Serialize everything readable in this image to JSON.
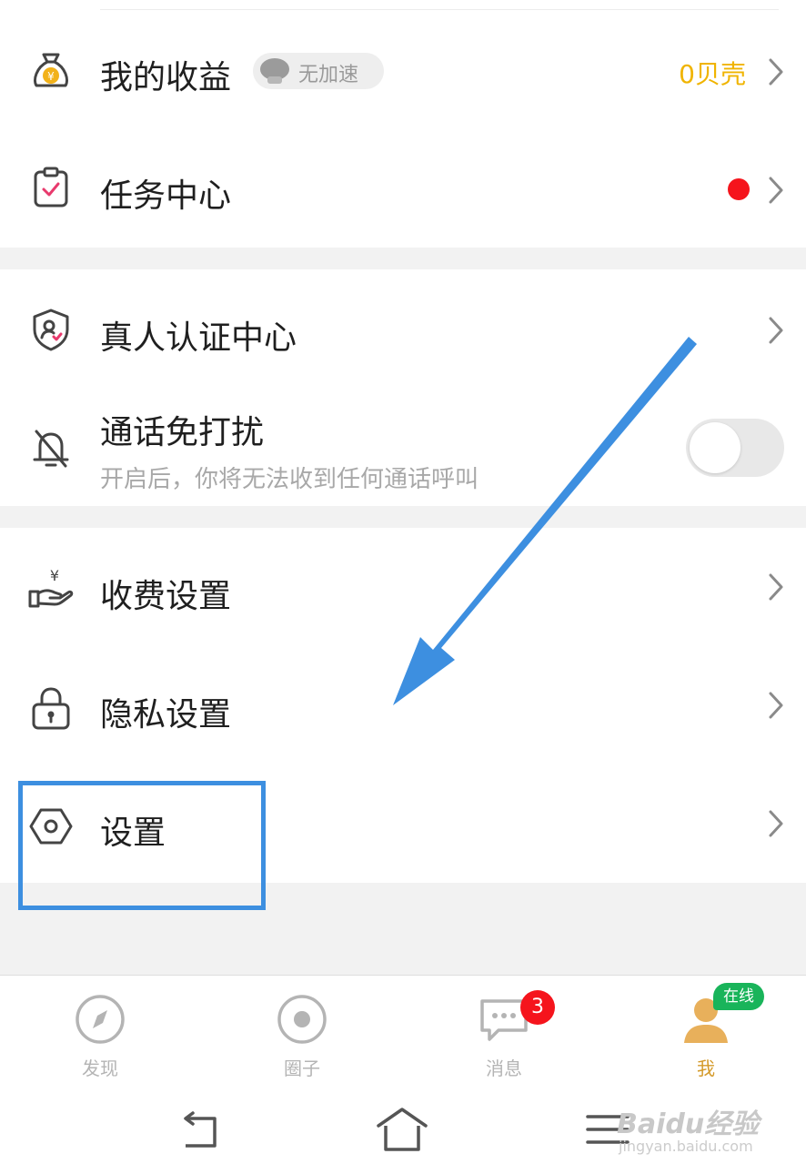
{
  "menu": {
    "earnings": {
      "label": "我的收益",
      "badge": "无加速",
      "value": "0贝壳",
      "icon": "money-bag-icon"
    },
    "tasks": {
      "label": "任务中心",
      "icon": "clipboard-check-icon"
    },
    "verify": {
      "label": "真人认证中心",
      "icon": "shield-person-icon"
    },
    "dnd": {
      "label": "通话免打扰",
      "sub": "开启后，你将无法收到任何通话呼叫",
      "icon": "bell-off-icon",
      "enabled": false
    },
    "fee": {
      "label": "收费设置",
      "icon": "hand-yen-icon"
    },
    "privacy": {
      "label": "隐私设置",
      "icon": "lock-icon"
    },
    "settings": {
      "label": "设置",
      "icon": "hexagon-settings-icon"
    }
  },
  "tabbar": {
    "tabs": [
      {
        "label": "发现",
        "icon": "compass-icon"
      },
      {
        "label": "圈子",
        "icon": "circle-dot-icon"
      },
      {
        "label": "消息",
        "icon": "chat-bubble-icon",
        "badge": "3"
      },
      {
        "label": "我",
        "icon": "user-avatar-icon",
        "badge": "在线",
        "active": true
      }
    ]
  },
  "watermark": {
    "text": "Baidu经验",
    "sub": "jingyan.baidu.com"
  },
  "colors": {
    "accent": "#f0b400",
    "annotation": "#3d8fe0",
    "red": "#f5141c",
    "online": "#19b45a",
    "active_tab": "#d49a2a"
  }
}
